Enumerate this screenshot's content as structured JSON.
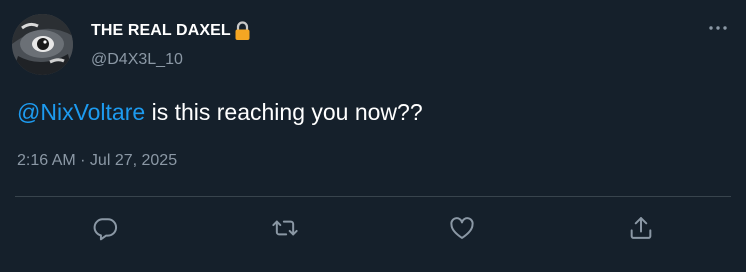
{
  "user": {
    "display_name": "THE REAL DAXEL",
    "handle": "@D4X3L_10",
    "protected_icon": "lock-icon"
  },
  "tweet": {
    "mention": "@NixVoltare",
    "text": " is this reaching you now??",
    "timestamp": "2:16 AM · Jul 27, 2025"
  },
  "actions": [
    {
      "name": "reply",
      "icon": "reply-icon"
    },
    {
      "name": "retweet",
      "icon": "retweet-icon"
    },
    {
      "name": "like",
      "icon": "heart-icon"
    },
    {
      "name": "share",
      "icon": "share-icon"
    }
  ],
  "colors": {
    "background": "#15202b",
    "accent": "#1d9bf0",
    "secondary_text": "#8b98a5",
    "lock": "#f5a623"
  }
}
